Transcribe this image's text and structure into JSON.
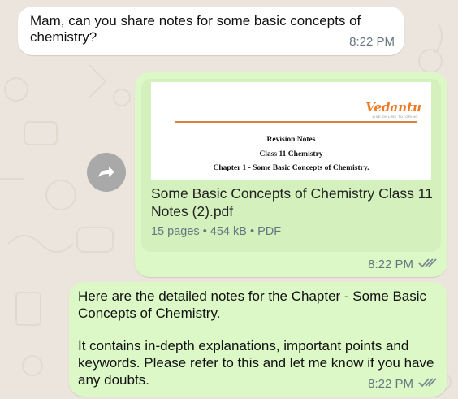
{
  "chat": {
    "incoming_message": {
      "text": "Mam, can you share notes for some basic concepts of chemistry?",
      "time": "8:22 PM"
    },
    "document_message": {
      "preview": {
        "logo": "Vedantu",
        "logo_tagline": "LIVE ONLINE TUTORING",
        "line1": "Revision Notes",
        "line2": "Class 11 Chemistry",
        "line3": "Chapter 1 - Some Basic Concepts of Chemistry."
      },
      "file_name": "Some Basic Concepts of Chemistry Class 11 Notes (2).pdf",
      "meta": "15 pages • 454 kB • PDF",
      "time": "8:22 PM",
      "status_icon": "double-check-read-icon"
    },
    "text_message": {
      "paragraph1": "Here are the detailed notes for the Chapter - Some Basic Concepts of Chemistry.",
      "paragraph2": "It contains in-depth explanations, important points and keywords. Please refer to this and let me know if you have any doubts.",
      "time": "8:22 PM",
      "status_icon": "double-check-read-icon"
    },
    "forward_icon": "forward-arrow-icon"
  },
  "colors": {
    "background": "#ece5dd",
    "incoming_bubble": "#ffffff",
    "outgoing_bubble": "#dcf8c6",
    "timestamp": "#667781",
    "brand_orange": "#f07a24"
  }
}
